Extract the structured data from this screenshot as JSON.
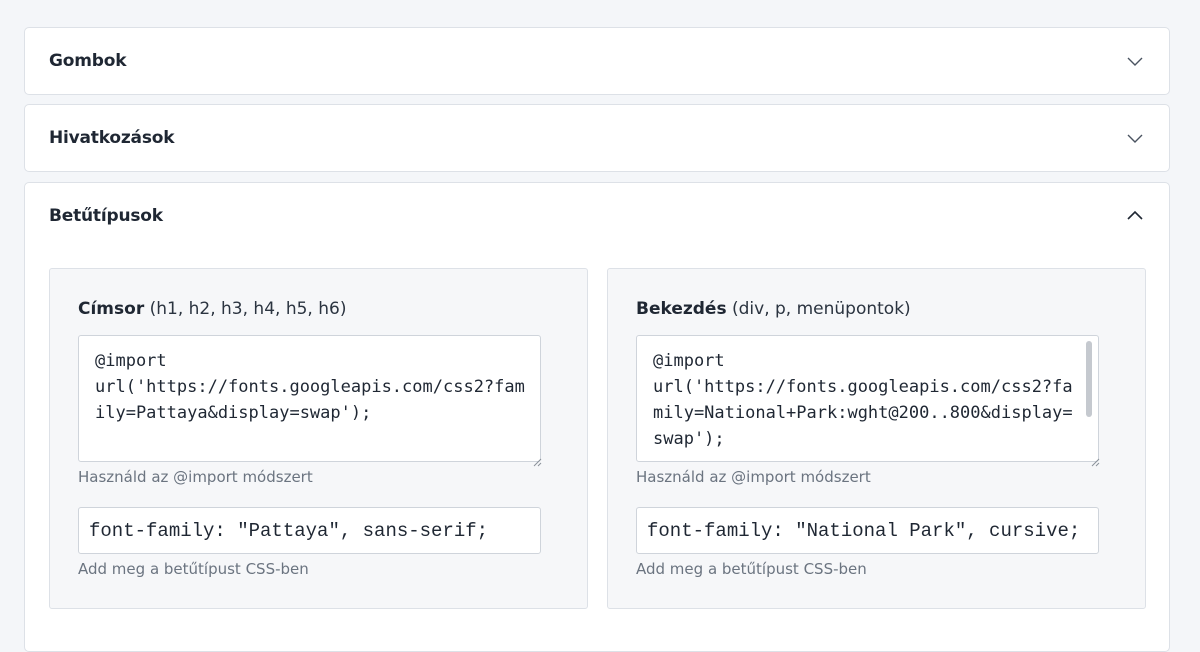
{
  "sections": [
    {
      "title": "Gombok",
      "expanded": false,
      "chevron_icon": "chevron-down-icon"
    },
    {
      "title": "Hivatkozások",
      "expanded": false,
      "chevron_icon": "chevron-down-icon"
    },
    {
      "title": "Betűtípusok",
      "expanded": true,
      "chevron_icon": "chevron-up-icon"
    }
  ],
  "fonts": {
    "heading": {
      "label_bold": "Címsor",
      "label_sub": " (h1, h2, h3, h4, h5, h6)",
      "import_value": "@import\nurl('https://fonts.googleapis.com/css2?family=Pattaya&display=swap');",
      "import_hint": "Használd az @import módszert",
      "family_value": "font-family: \"Pattaya\", sans-serif;",
      "family_hint": "Add meg a betűtípust CSS-ben"
    },
    "paragraph": {
      "label_bold": "Bekezdés",
      "label_sub": " (div, p, menüpontok)",
      "import_value": "@import\nurl('https://fonts.googleapis.com/css2?family=National+Park:wght@200..800&display=swap');",
      "import_hint": "Használd az @import módszert",
      "family_value": "font-family: \"National Park\", cursive;",
      "family_hint": "Add meg a betűtípust CSS-ben"
    }
  },
  "colors": {
    "page_bg": "#f4f6f9",
    "card_bg": "#ffffff",
    "panel_bg": "#f6f7f9",
    "border": "#dde1e7",
    "text": "#1f2733",
    "hint": "#6b7480"
  }
}
